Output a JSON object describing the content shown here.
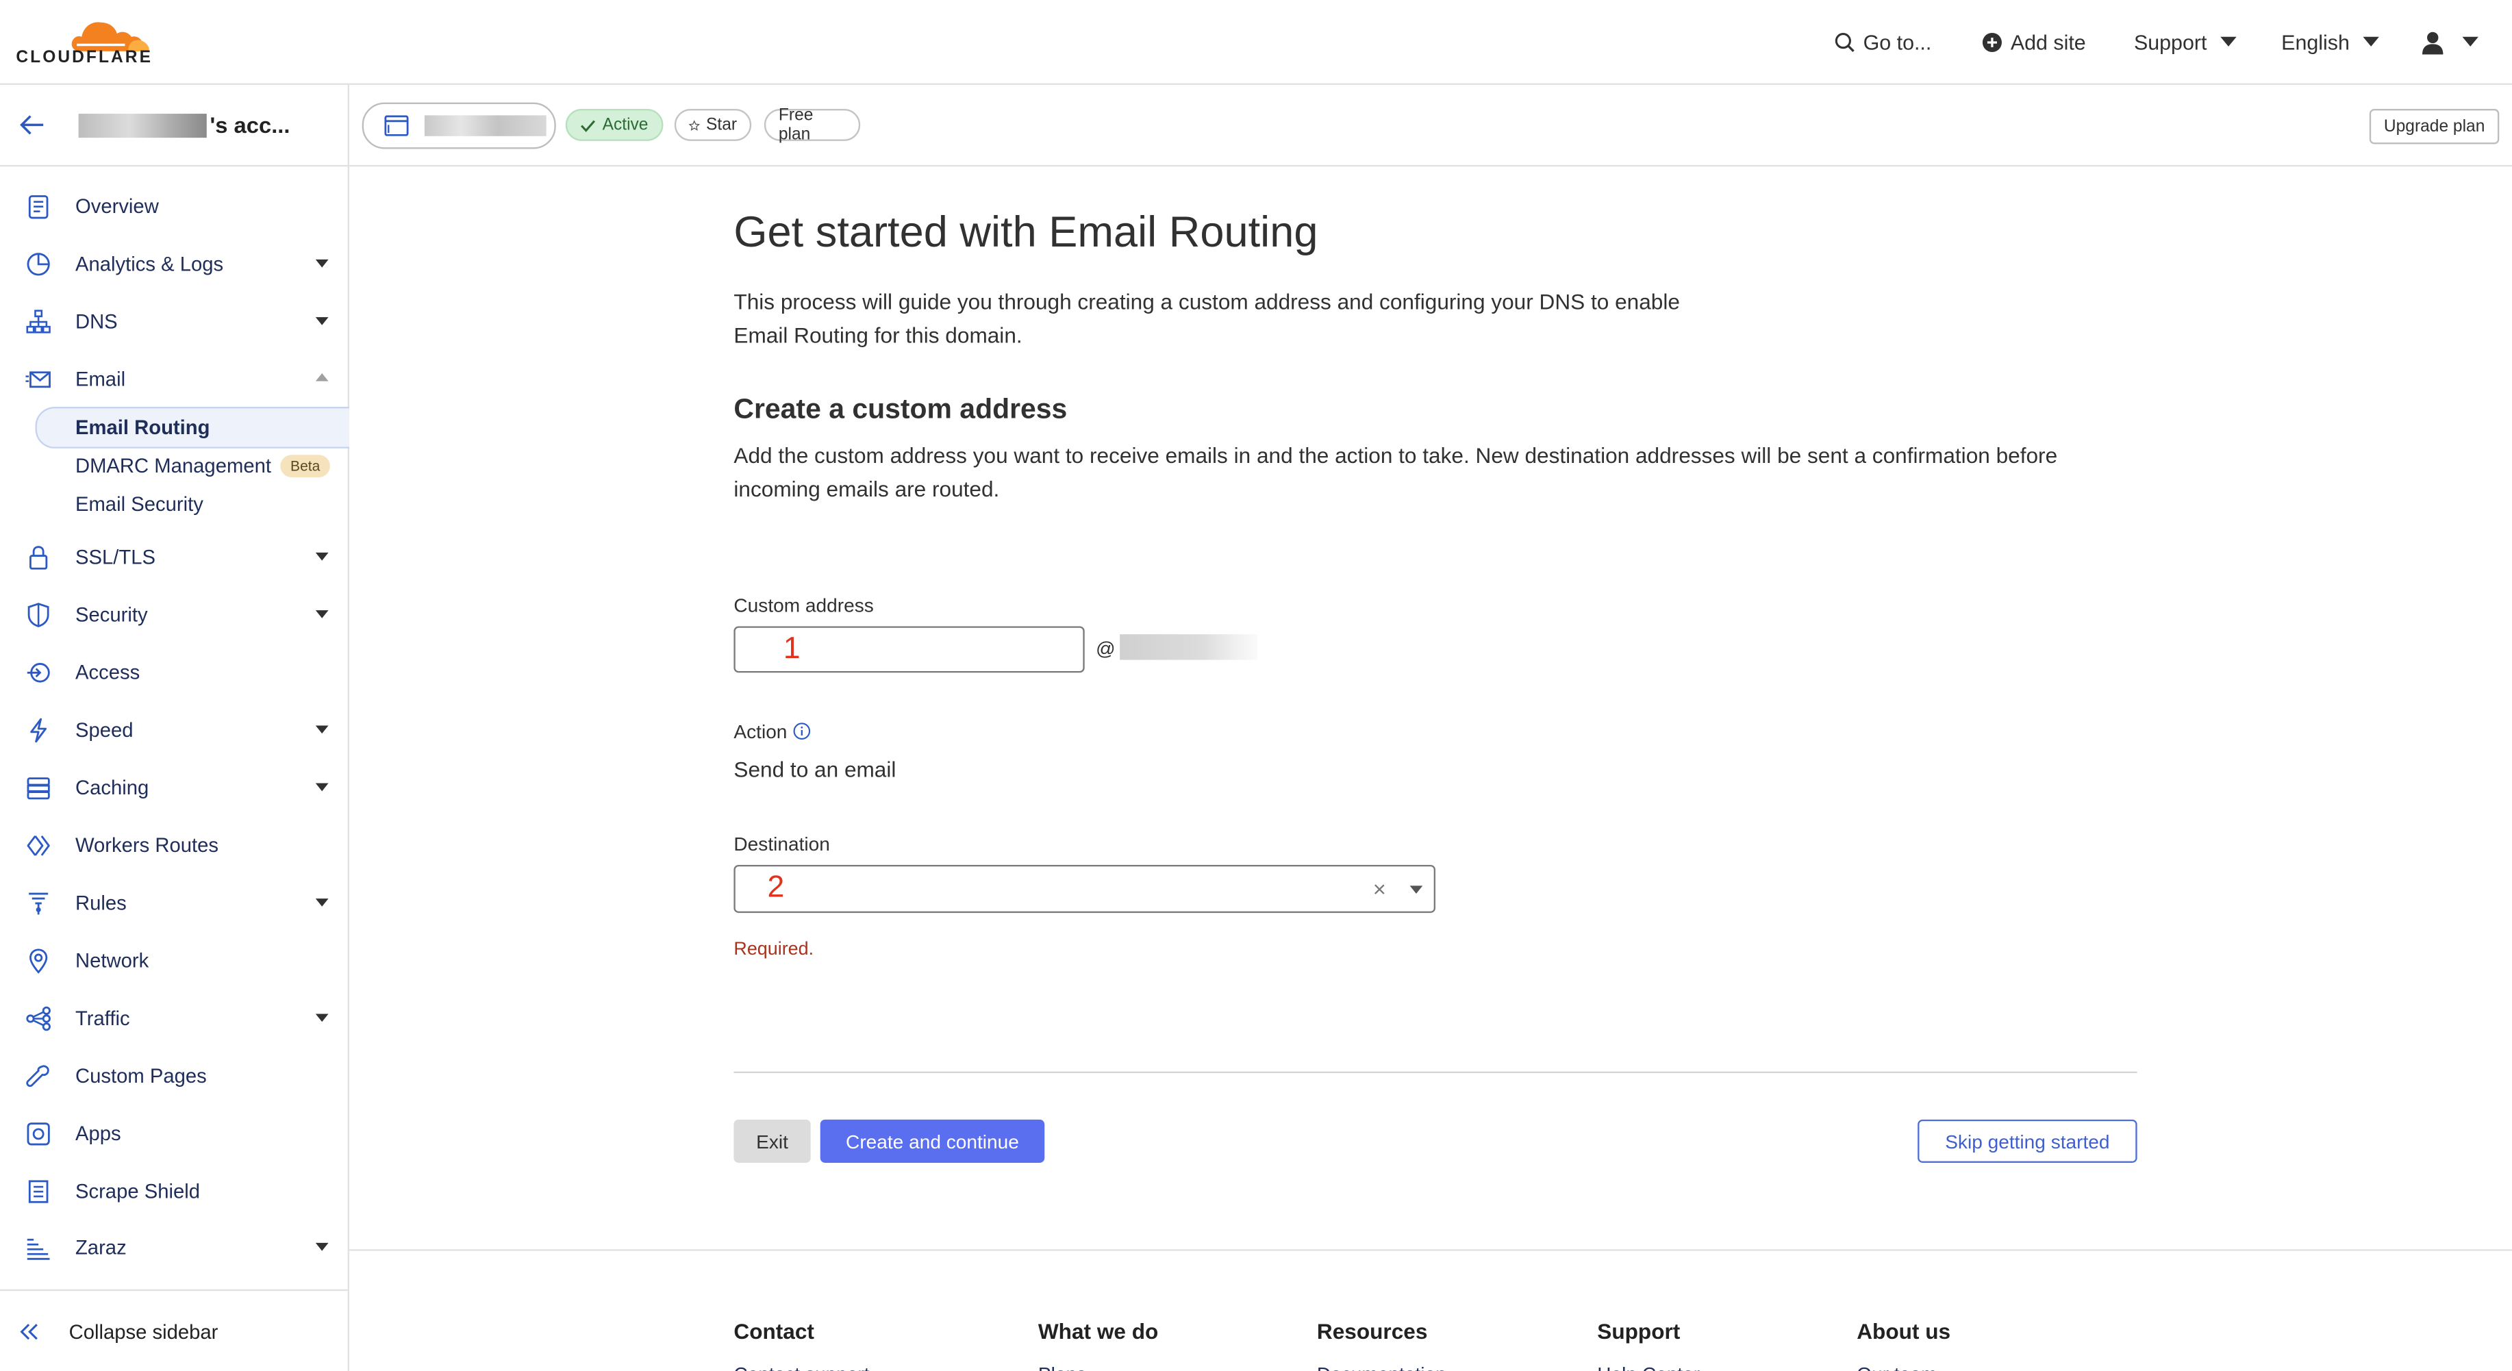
{
  "app": {
    "logo_text": "CLOUDFLARE",
    "accent": "#f48120"
  },
  "topnav": {
    "goto": "Go to...",
    "add_site": "Add site",
    "support": "Support",
    "language": "English"
  },
  "account": {
    "name_suffix": "'s acc..."
  },
  "zone": {
    "status": "Active",
    "star": "Star",
    "plan": "Free plan",
    "upgrade": "Upgrade plan"
  },
  "sidebar": {
    "items": [
      {
        "label": "Overview",
        "icon": "clipboard-icon"
      },
      {
        "label": "Analytics & Logs",
        "icon": "pie-chart-icon"
      },
      {
        "label": "DNS",
        "icon": "sitemap-icon"
      },
      {
        "label": "Email",
        "icon": "email-icon"
      },
      {
        "label": "SSL/TLS",
        "icon": "lock-icon"
      },
      {
        "label": "Security",
        "icon": "shield-icon"
      },
      {
        "label": "Access",
        "icon": "access-icon"
      },
      {
        "label": "Speed",
        "icon": "bolt-icon"
      },
      {
        "label": "Caching",
        "icon": "server-icon"
      },
      {
        "label": "Workers Routes",
        "icon": "workers-icon"
      },
      {
        "label": "Rules",
        "icon": "rules-icon"
      },
      {
        "label": "Network",
        "icon": "location-pin-icon"
      },
      {
        "label": "Traffic",
        "icon": "traffic-icon"
      },
      {
        "label": "Custom Pages",
        "icon": "wrench-icon"
      },
      {
        "label": "Apps",
        "icon": "apps-icon"
      },
      {
        "label": "Scrape Shield",
        "icon": "document-icon"
      },
      {
        "label": "Zaraz",
        "icon": "zaraz-icon"
      }
    ],
    "email_sub": {
      "routing": "Email Routing",
      "dmarc": "DMARC Management",
      "dmarc_badge": "Beta",
      "security": "Email Security"
    },
    "collapse": "Collapse sidebar"
  },
  "main": {
    "title": "Get started with Email Routing",
    "description": "This process will guide you through creating a custom address and configuring your DNS to enable Email Routing for this domain.",
    "section_title": "Create a custom address",
    "section_desc": "Add the custom address you want to receive emails in and the action to take. New destination addresses will be sent a confirmation before incoming emails are routed.",
    "custom_address_label": "Custom address",
    "custom_address_marker": "1",
    "at_sign": "@",
    "action_label": "Action",
    "action_value": "Send to an email",
    "destination_label": "Destination",
    "destination_marker": "2",
    "clear_symbol": "×",
    "required": "Required.",
    "exit": "Exit",
    "create": "Create and continue",
    "skip": "Skip getting started"
  },
  "footer": {
    "contact": "Contact",
    "what_we_do": "What we do",
    "resources": "Resources",
    "support": "Support",
    "about": "About us",
    "contact_link": "Contact support",
    "what_link": "Plans",
    "resources_link": "Documentation",
    "support_link": "Help Center",
    "about_link": "Our team"
  }
}
